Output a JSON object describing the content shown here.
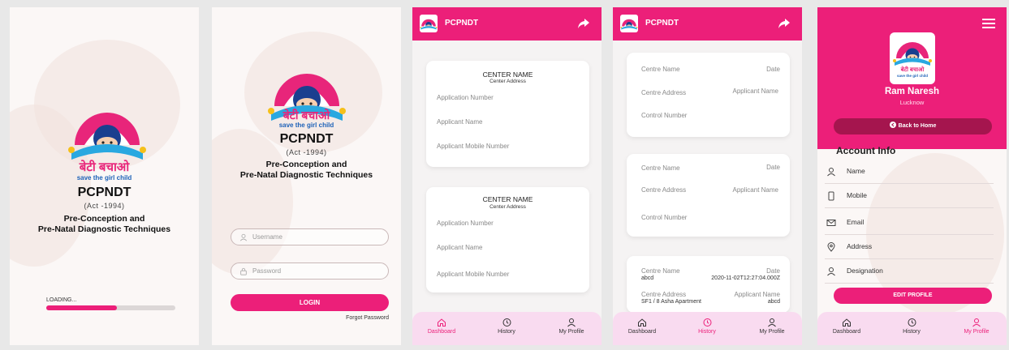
{
  "colors": {
    "accent": "#ec1f79",
    "dark_accent": "#a5154e",
    "nav_bg": "#f9dbf0"
  },
  "logo": {
    "hindi": "बेटी बचाओ",
    "english": "save the girl child"
  },
  "splash": {
    "brand": "PCPNDT",
    "act": "(Act -1994)",
    "full_line1": "Pre-Conception and",
    "full_line2": "Pre-Natal Diagnostic Techniques",
    "loading": "LOADING...",
    "progress": 0.55
  },
  "login": {
    "brand": "PCPNDT",
    "act": "(Act -1994)",
    "full_line1": "Pre-Conception and",
    "full_line2": "Pre-Natal Diagnostic Techniques",
    "username_placeholder": "Username",
    "password_placeholder": "Password",
    "login_label": "LOGIN",
    "forgot": "Forgot Password"
  },
  "dashboard": {
    "title": "PCPNDT",
    "cards": [
      {
        "center_name": "CENTER NAME",
        "center_address": "Center Address",
        "application_number": "Application Number",
        "applicant_name": "Applicant Name",
        "mobile": "Applicant Mobile Number"
      },
      {
        "center_name": "CENTER NAME",
        "center_address": "Center Address",
        "application_number": "Application Number",
        "applicant_name": "Applicant Name",
        "mobile": "Applicant Mobile Number"
      }
    ]
  },
  "history": {
    "title": "PCPNDT",
    "cards": [
      {
        "centre_name": "Centre Name",
        "date": "Date",
        "centre_address": "Centre Address",
        "applicant_name": "Applicant Name",
        "control_number": "Control Number"
      },
      {
        "centre_name": "Centre Name",
        "date": "Date",
        "centre_address": "Centre Address",
        "applicant_name": "Applicant Name",
        "control_number": "Control Number"
      }
    ],
    "filled_card": {
      "centre_name_label": "Centre Name",
      "centre_name_value": "abcd",
      "date_label": "Date",
      "date_value": "2020-11-02T12:27:04.000Z",
      "centre_address_label": "Centre Address",
      "centre_address_value": "SF1 / 8 Asha Apartment",
      "applicant_name_label": "Applicant Name",
      "applicant_name_value": "abcd"
    }
  },
  "profile": {
    "name": "Ram Naresh",
    "city": "Lucknow",
    "back_home": "Back to Home",
    "account_info": "Account Info",
    "fields": [
      "Name",
      "Mobile",
      "Email",
      "Address",
      "Designation"
    ],
    "edit_profile": "EDIT PROFILE"
  },
  "nav": {
    "dashboard": "Dashboard",
    "history": "History",
    "my_profile": "My Profile"
  }
}
